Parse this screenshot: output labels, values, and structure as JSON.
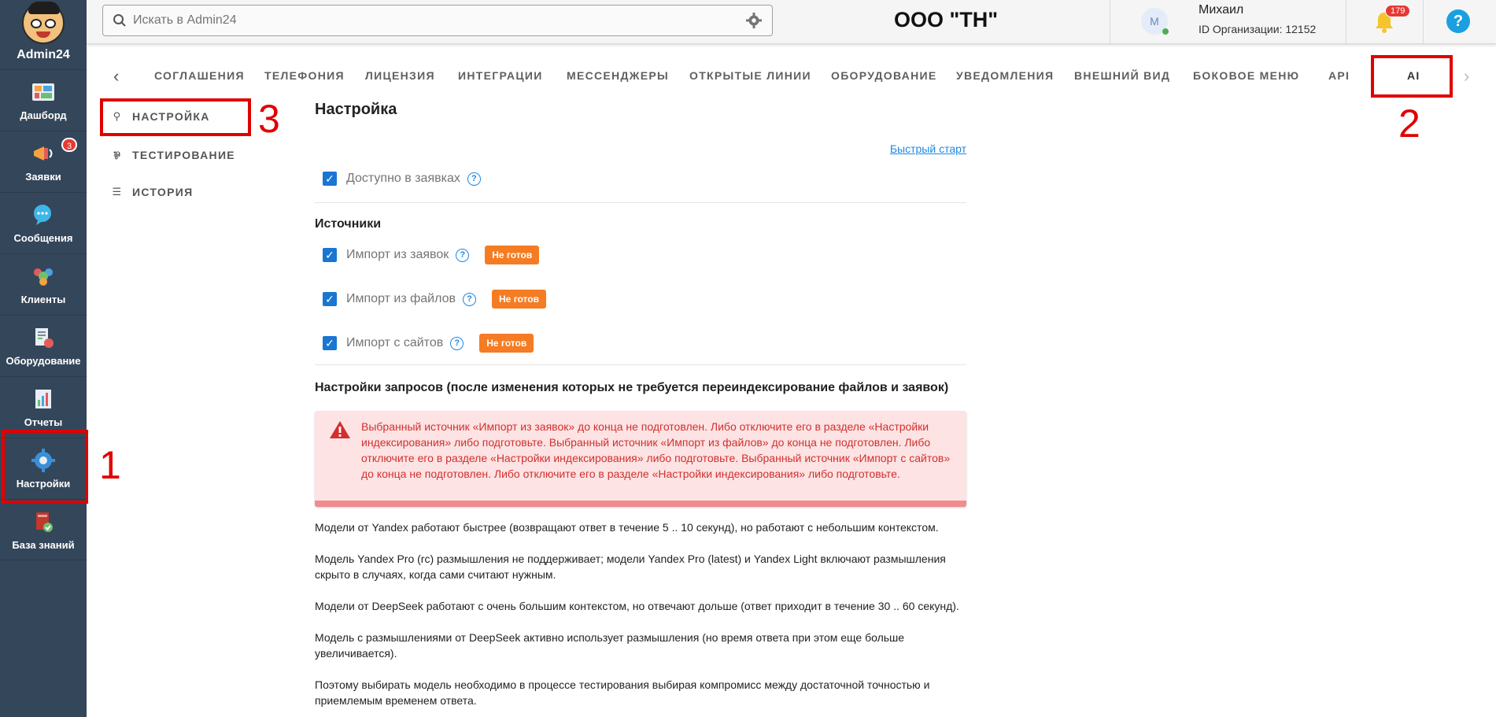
{
  "app": {
    "name": "Admin24"
  },
  "sidebar": {
    "items": [
      {
        "label": "Дашборд",
        "icon": "dashboard-icon"
      },
      {
        "label": "Заявки",
        "icon": "megaphone-icon",
        "badge": "3"
      },
      {
        "label": "Сообщения",
        "icon": "chat-icon"
      },
      {
        "label": "Клиенты",
        "icon": "clients-icon"
      },
      {
        "label": "Оборудование",
        "icon": "equipment-icon"
      },
      {
        "label": "Отчеты",
        "icon": "reports-icon"
      },
      {
        "label": "Настройки",
        "icon": "gear-icon"
      },
      {
        "label": "База знаний",
        "icon": "book-icon"
      }
    ]
  },
  "header": {
    "search_placeholder": "Искать в Admin24",
    "org_title": "ООО \"ТН\"",
    "avatar_letter": "М",
    "user_name": "Михаил",
    "org_id": "ID Организации: 12152",
    "notifications_count": "179",
    "help": "?"
  },
  "tabs": [
    "СОГЛАШЕНИЯ",
    "ТЕЛЕФОНИЯ",
    "ЛИЦЕНЗИЯ",
    "ИНТЕГРАЦИИ",
    "МЕССЕНДЖЕРЫ",
    "ОТКРЫТЫЕ ЛИНИИ",
    "ОБОРУДОВАНИЕ",
    "УВЕДОМЛЕНИЯ",
    "ВНЕШНИЙ ВИД",
    "БОКОВОЕ МЕНЮ",
    "API",
    "AI"
  ],
  "subnav": [
    "НАСТРОЙКА",
    "ТЕСТИРОВАНИЕ",
    "ИСТОРИЯ"
  ],
  "annotations": [
    "1",
    "2",
    "3"
  ],
  "main": {
    "title": "Настройка",
    "quick_start": "Быстрый старт",
    "available_label": "Доступно в заявках",
    "sources_title": "Источники",
    "sources": [
      {
        "label": "Импорт из заявок",
        "status": "Не готов"
      },
      {
        "label": "Импорт из файлов",
        "status": "Не готов"
      },
      {
        "label": "Импорт с сайтов",
        "status": "Не готов"
      }
    ],
    "requests_title": "Настройки запросов (после изменения которых не требуется переиндексирование файлов и заявок)",
    "alert_text": "Выбранный источник «Импорт из заявок» до конца не подготовлен. Либо отключите его в разделе «Настройки индексирования» либо подготовьте. Выбранный источник «Импорт из файлов» до конца не подготовлен. Либо отключите его в разделе «Настройки индексирования» либо подготовьте. Выбранный источник «Импорт с сайтов» до конца не подготовлен. Либо отключите его в разделе «Настройки индексирования» либо подготовьте.",
    "para1": "Модели от Yandex работают быстрее (возвращают ответ в течение 5 .. 10 секунд), но работают с небольшим контекстом.",
    "para2": "Модель Yandex Pro (rc) размышления не поддерживает; модели Yandex Pro (latest) и Yandex Light включают размышления скрыто в случаях, когда сами считают нужным.",
    "para3": "Модели от DeepSeek работают с очень большим контекстом, но отвечают дольше (ответ приходит в течение 30 .. 60 секунд).",
    "para4": "Модель с размышлениями от DeepSeek активно использует размышления (но время ответа при этом еще больше увеличивается).",
    "para5": "Поэтому выбирать модель необходимо в процессе тестирования выбирая компромисс между достаточной точностью и приемлемым временем ответа."
  }
}
